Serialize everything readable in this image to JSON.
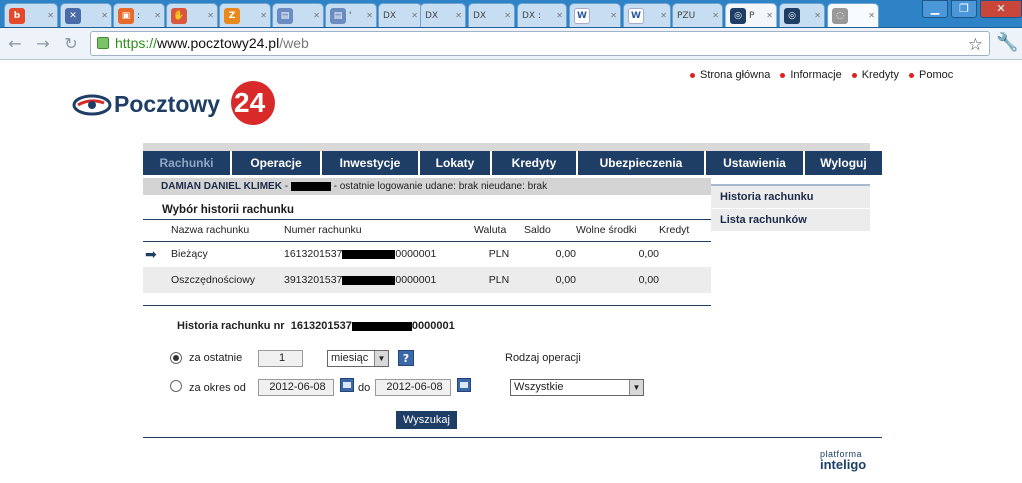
{
  "browser": {
    "tabs": [
      {
        "label": "",
        "icon": "b-icon",
        "color": "#e4492a",
        "glyph": "b"
      },
      {
        "label": "",
        "icon": "x-icon",
        "color": "#4b6ba8",
        "glyph": "✕"
      },
      {
        "label": ":",
        "icon": "page-icon",
        "color": "#e86a2a",
        "glyph": "▣"
      },
      {
        "label": "",
        "icon": "hand-icon",
        "color": "#d9573a",
        "glyph": "✋"
      },
      {
        "label": "",
        "icon": "z-icon",
        "color": "#e8891d",
        "glyph": "Z"
      },
      {
        "label": "",
        "icon": "doc-icon",
        "color": "#6b8cc2",
        "glyph": "▤"
      },
      {
        "label": "'",
        "icon": "doc-icon",
        "color": "#6b8cc2",
        "glyph": "▤"
      },
      {
        "label": "DX",
        "icon": "",
        "color": "",
        "glyph": ""
      },
      {
        "label": "DX",
        "icon": "",
        "color": "",
        "glyph": ""
      },
      {
        "label": "DX",
        "icon": "",
        "color": "",
        "glyph": ""
      },
      {
        "label": "DX :",
        "icon": "",
        "color": "",
        "glyph": ""
      },
      {
        "label": "",
        "icon": "w-icon",
        "color": "#fff",
        "glyph": "W"
      },
      {
        "label": "",
        "icon": "w-icon",
        "color": "#fff",
        "glyph": "W"
      },
      {
        "label": "PZU",
        "icon": "",
        "color": "",
        "glyph": ""
      },
      {
        "label": "P",
        "icon": "pocztowy-icon",
        "color": "#1e3e66",
        "glyph": "◎"
      },
      {
        "label": "",
        "icon": "pocztowy-icon",
        "color": "#1e3e66",
        "glyph": "◎"
      },
      {
        "label": "",
        "icon": "globe-icon",
        "color": "#999",
        "glyph": "◌"
      }
    ],
    "window": {
      "minimize": "▁",
      "maximize": "❐",
      "close": "✕"
    },
    "nav": {
      "back": "←",
      "forward": "→",
      "reload": "↻"
    },
    "url": {
      "scheme": "https://",
      "domain": "www.pocztowy24.pl",
      "path": "/web"
    }
  },
  "toplinks": [
    "Strona główna",
    "Informacje",
    "Kredyty",
    "Pomoc"
  ],
  "logo": {
    "text": "Pocztowy",
    "number": "24"
  },
  "nav": {
    "items": [
      "Rachunki",
      "Operacje",
      "Inwestycje",
      "Lokaty",
      "Kredyty",
      "Ubezpieczenia",
      "Ustawienia",
      "Wyloguj"
    ],
    "active": "Rachunki"
  },
  "user": {
    "name": "DAMIAN DANIEL KLIMEK",
    "dash": "-",
    "info": "- ostatnie logowanie udane: brak nieudane: brak"
  },
  "sidemenu": [
    "Historia rachunku",
    "Lista rachunków"
  ],
  "section_title": "Wybór historii rachunku",
  "table": {
    "headers": [
      "Nazwa rachunku",
      "Numer rachunku",
      "Waluta",
      "Saldo",
      "Wolne środki",
      "Kredyt"
    ],
    "rows": [
      {
        "name": "Bieżący",
        "num_start": "1613201537",
        "num_end": "0000001",
        "currency": "PLN",
        "saldo": "0,00",
        "free": "0,00",
        "credit": "",
        "selected": true
      },
      {
        "name": "Oszczędnościowy",
        "num_start": "3913201537",
        "num_end": "0000001",
        "currency": "PLN",
        "saldo": "0,00",
        "free": "0,00",
        "credit": "",
        "selected": false
      }
    ]
  },
  "history": {
    "title_prefix": "Historia rachunku nr",
    "num_start": "1613201537",
    "num_end": "0000001",
    "last_label": "za ostatnie",
    "last_value": "1",
    "unit": "miesiąc",
    "range_label": "za okres od",
    "from": "2012-06-08",
    "to_label": "do",
    "to": "2012-06-08",
    "type_label": "Rodzaj operacji",
    "type_value": "Wszystkie",
    "search": "Wyszukaj",
    "help": "?"
  },
  "footer": {
    "line1": "platforma",
    "line2": "inteligo"
  }
}
